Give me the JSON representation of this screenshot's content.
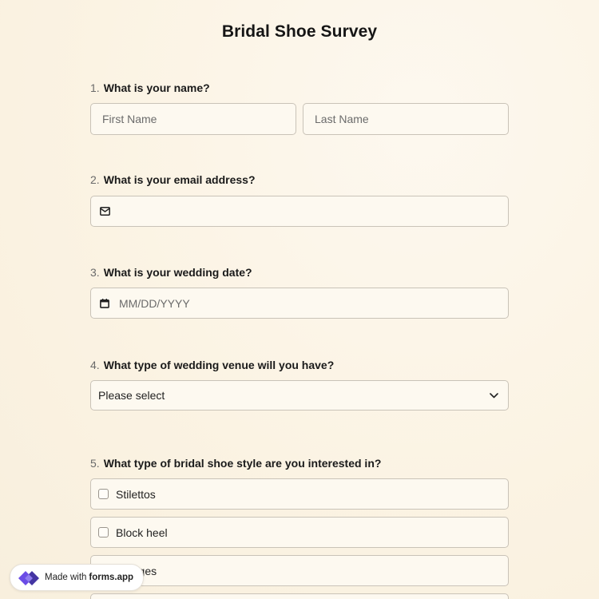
{
  "form": {
    "title": "Bridal Shoe Survey",
    "questions": [
      {
        "number": "1.",
        "label": "What is your name?"
      },
      {
        "number": "2.",
        "label": "What is your email address?"
      },
      {
        "number": "3.",
        "label": "What is your wedding date?"
      },
      {
        "number": "4.",
        "label": "What type of wedding venue will you have?"
      },
      {
        "number": "5.",
        "label": "What type of bridal shoe style are you interested in?"
      }
    ],
    "name": {
      "first_placeholder": "First Name",
      "last_placeholder": "Last Name",
      "first_value": "",
      "last_value": ""
    },
    "email": {
      "value": "",
      "placeholder": "",
      "icon": "mail-icon"
    },
    "date": {
      "placeholder": "MM/DD/YYYY",
      "value": "",
      "icon": "calendar-icon"
    },
    "venue": {
      "selected": "Please select",
      "icon": "chevron-down-icon"
    },
    "shoe_styles": [
      "Stilettos",
      "Block heel",
      "Wedges"
    ]
  },
  "badge": {
    "prefix": "Made with",
    "brand": "forms.app",
    "icon": "forms-app-logo-icon"
  },
  "colors": {
    "background": "#fbf4e6",
    "field_background": "#fdf9f0",
    "field_border": "#c9c3b8",
    "logo_purple": "#6b4ce6"
  }
}
